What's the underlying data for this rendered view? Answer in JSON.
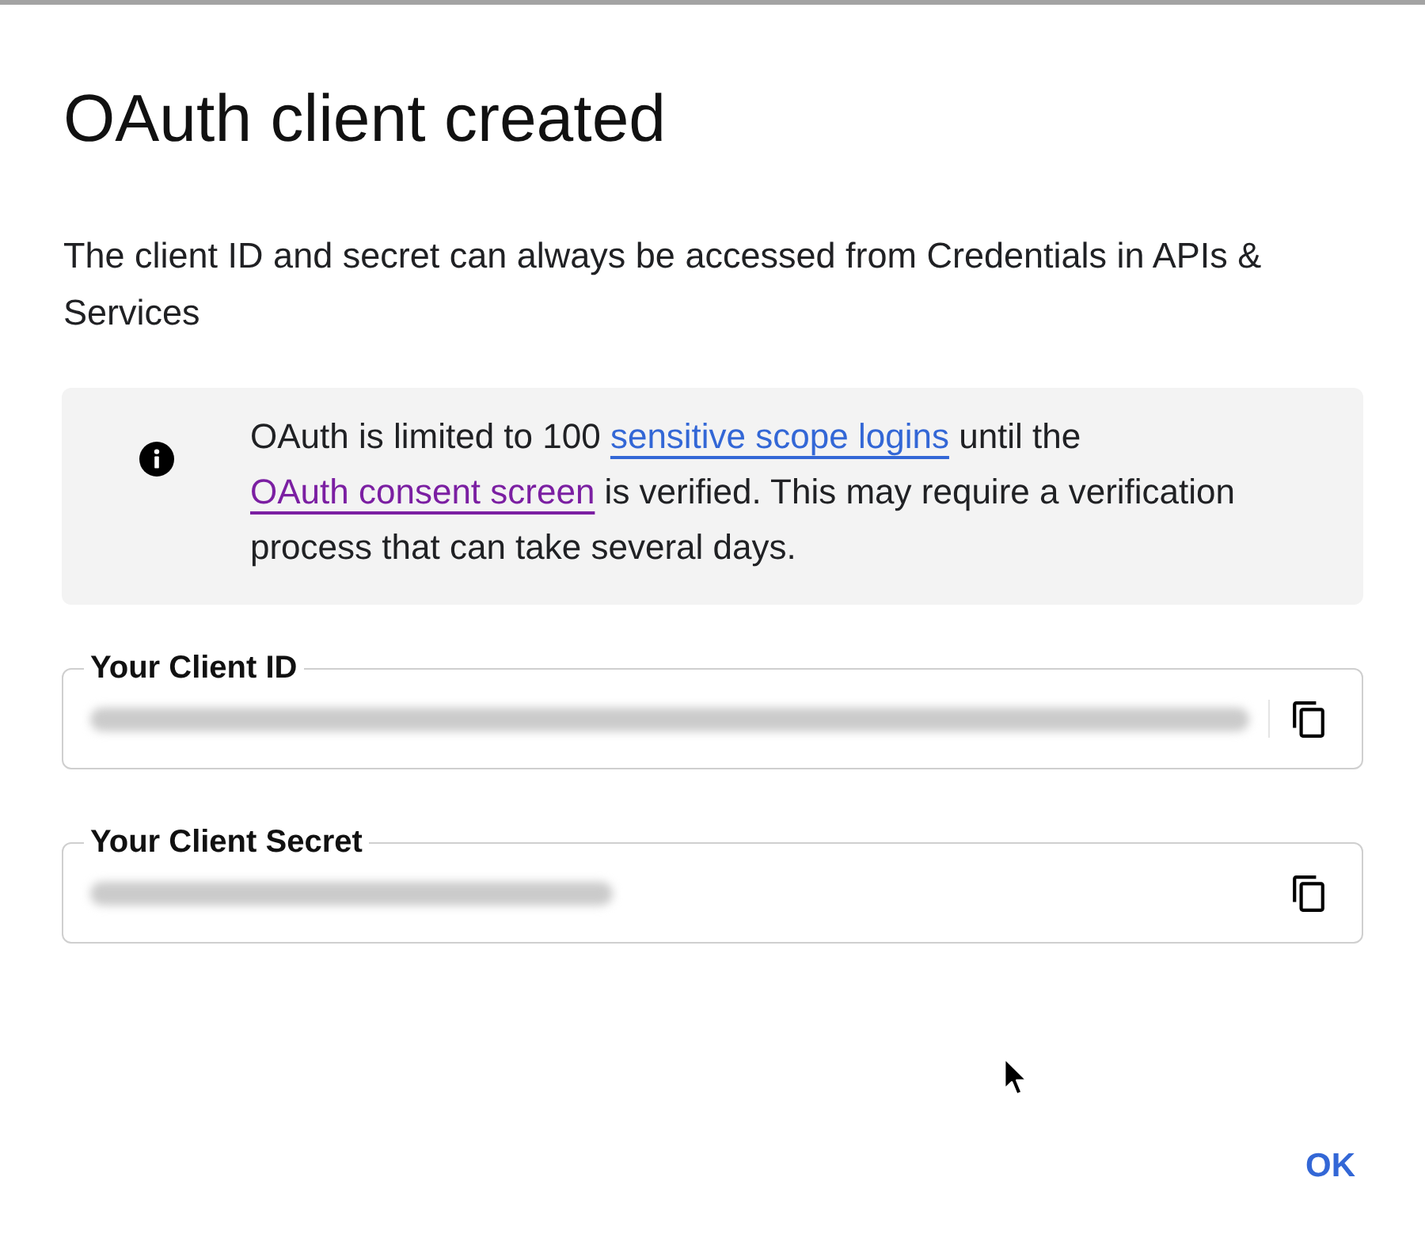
{
  "dialog": {
    "title": "OAuth client created",
    "description": "The client ID and secret can always be accessed from Credentials in APIs & Services"
  },
  "notice": {
    "segments": [
      {
        "kind": "text",
        "text": "OAuth is limited to 100 "
      },
      {
        "kind": "link",
        "text": "sensitive scope logins",
        "visited": false
      },
      {
        "kind": "text",
        "text": " until the "
      },
      {
        "kind": "link",
        "text": "OAuth consent screen",
        "visited": true
      },
      {
        "kind": "text",
        "text": " is verified. This may require a verification process that can take several days."
      }
    ]
  },
  "fields": [
    {
      "label": "Your Client ID",
      "value_blurred": true,
      "value_overflows": true
    },
    {
      "label": "Your Client Secret",
      "value_blurred": true,
      "value_overflows": false
    }
  ],
  "actions": [
    {
      "label": "OK"
    }
  ]
}
